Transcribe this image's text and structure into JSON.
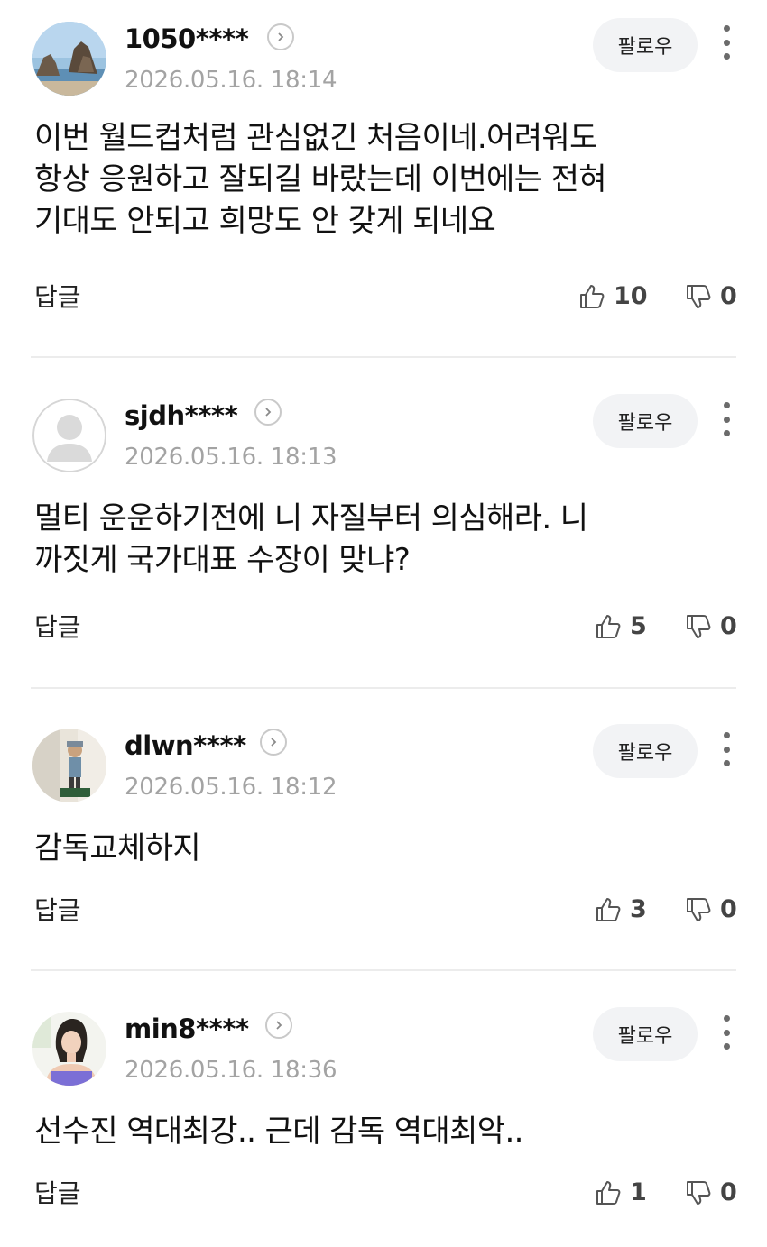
{
  "comments": [
    {
      "nickname": "1050****",
      "time": "2026.05.16. 18:14",
      "follow": "팔로우",
      "text": "이번 월드컵처럼 관심없긴 처음이네.어려워도\n항상 응원하고 잘되길 바랐는데 이번에는 전혀\n기대도 안되고 희망도 안 갖게 되네요",
      "reply": "답글",
      "likes": "10",
      "dislikes": "0",
      "avatar": "rocky-sea-photo"
    },
    {
      "nickname": "sjdh****",
      "time": "2026.05.16. 18:13",
      "follow": "팔로우",
      "text": "멀티 운운하기전에 니 자질부터 의심해라. 니\n까짓게 국가대표 수장이 맞냐?",
      "reply": "답글",
      "likes": "5",
      "dislikes": "0",
      "avatar": "default-user"
    },
    {
      "nickname": "dlwn****",
      "time": "2026.05.16. 18:12",
      "follow": "팔로우",
      "text": "감독교체하지",
      "reply": "답글",
      "likes": "3",
      "dislikes": "0",
      "avatar": "figurine-photo"
    },
    {
      "nickname": "min8****",
      "time": "2026.05.16. 18:36",
      "follow": "팔로우",
      "text": "선수진 역대최강.. 근데 감독 역대최악..",
      "reply": "답글",
      "likes": "1",
      "dislikes": "0",
      "avatar": "person-photo"
    }
  ],
  "colors": {
    "text": "#111111",
    "muted": "#a3a3a3",
    "follow_bg": "#f2f3f5",
    "divider": "#ececec"
  }
}
